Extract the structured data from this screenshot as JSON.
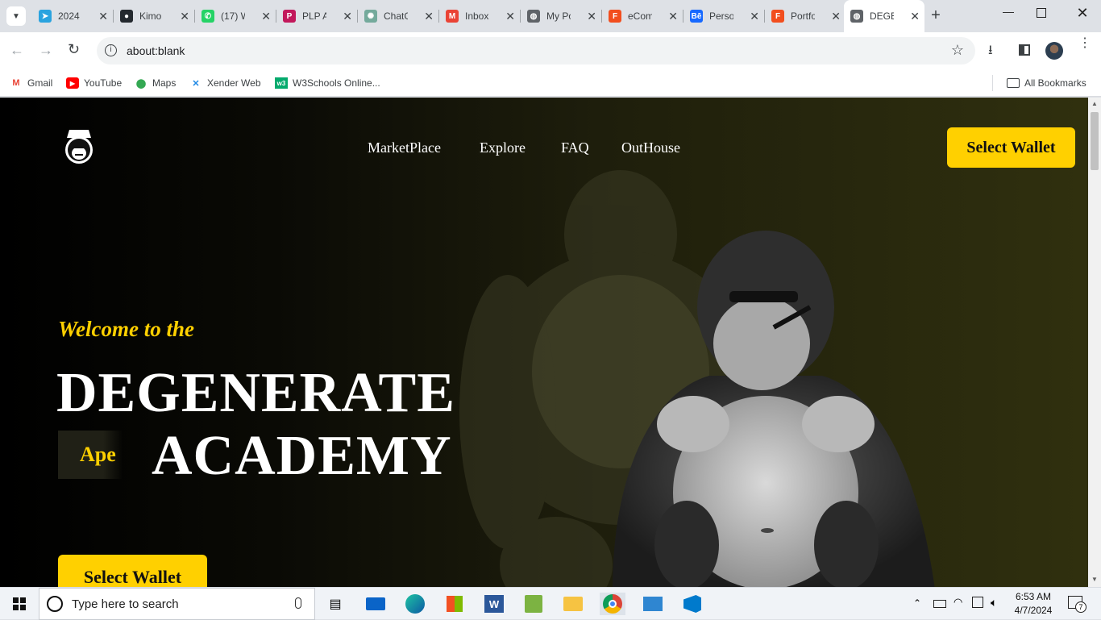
{
  "browser": {
    "tabs": [
      {
        "label": "2024",
        "icon": "telegram-icon",
        "color": "#2aa3df"
      },
      {
        "label": "Kimo",
        "icon": "github-icon",
        "color": "#24292f"
      },
      {
        "label": "(17) W",
        "icon": "whatsapp-icon",
        "color": "#25d366"
      },
      {
        "label": "PLP A",
        "icon": "plp-icon",
        "color": "#c2185b"
      },
      {
        "label": "ChatG",
        "icon": "chatgpt-icon",
        "color": "#74aa9c"
      },
      {
        "label": "Inbox",
        "icon": "gmail-icon",
        "color": "#ea4335"
      },
      {
        "label": "My Po",
        "icon": "globe-icon",
        "color": "#5f6368"
      },
      {
        "label": "eCom",
        "icon": "figma-icon",
        "color": "#f24e1e"
      },
      {
        "label": "Perso",
        "icon": "behance-icon",
        "color": "#1769ff"
      },
      {
        "label": "Portfo",
        "icon": "figma-icon",
        "color": "#f24e1e"
      },
      {
        "label": "DEGE",
        "icon": "globe-icon",
        "color": "#5f6368"
      }
    ],
    "url": "about:blank",
    "bookmarks": [
      {
        "label": "Gmail",
        "icon": "gmail-icon",
        "color": "#ea4335"
      },
      {
        "label": "YouTube",
        "icon": "youtube-icon",
        "color": "#ff0000"
      },
      {
        "label": "Maps",
        "icon": "maps-icon",
        "color": "#34a853"
      },
      {
        "label": "Xender Web",
        "icon": "xender-icon",
        "color": "#1e88e5"
      },
      {
        "label": "W3Schools Online...",
        "icon": "w3schools-icon",
        "color": "#04aa6d"
      }
    ],
    "all_bookmarks": "All Bookmarks"
  },
  "site": {
    "nav": [
      "MarketPlace",
      "Explore",
      "FAQ",
      "OutHouse"
    ],
    "wallet_button": "Select Wallet",
    "welcome": "Welcome to the",
    "title_line1": "DEGENERATE",
    "tag": "Ape",
    "title_line2": "ACADEMY",
    "cta_button": "Select Wallet",
    "accent": "#ffd000"
  },
  "taskbar": {
    "search_placeholder": "Type here to search",
    "time": "6:53 AM",
    "date": "4/7/2024",
    "notifications": "7"
  }
}
